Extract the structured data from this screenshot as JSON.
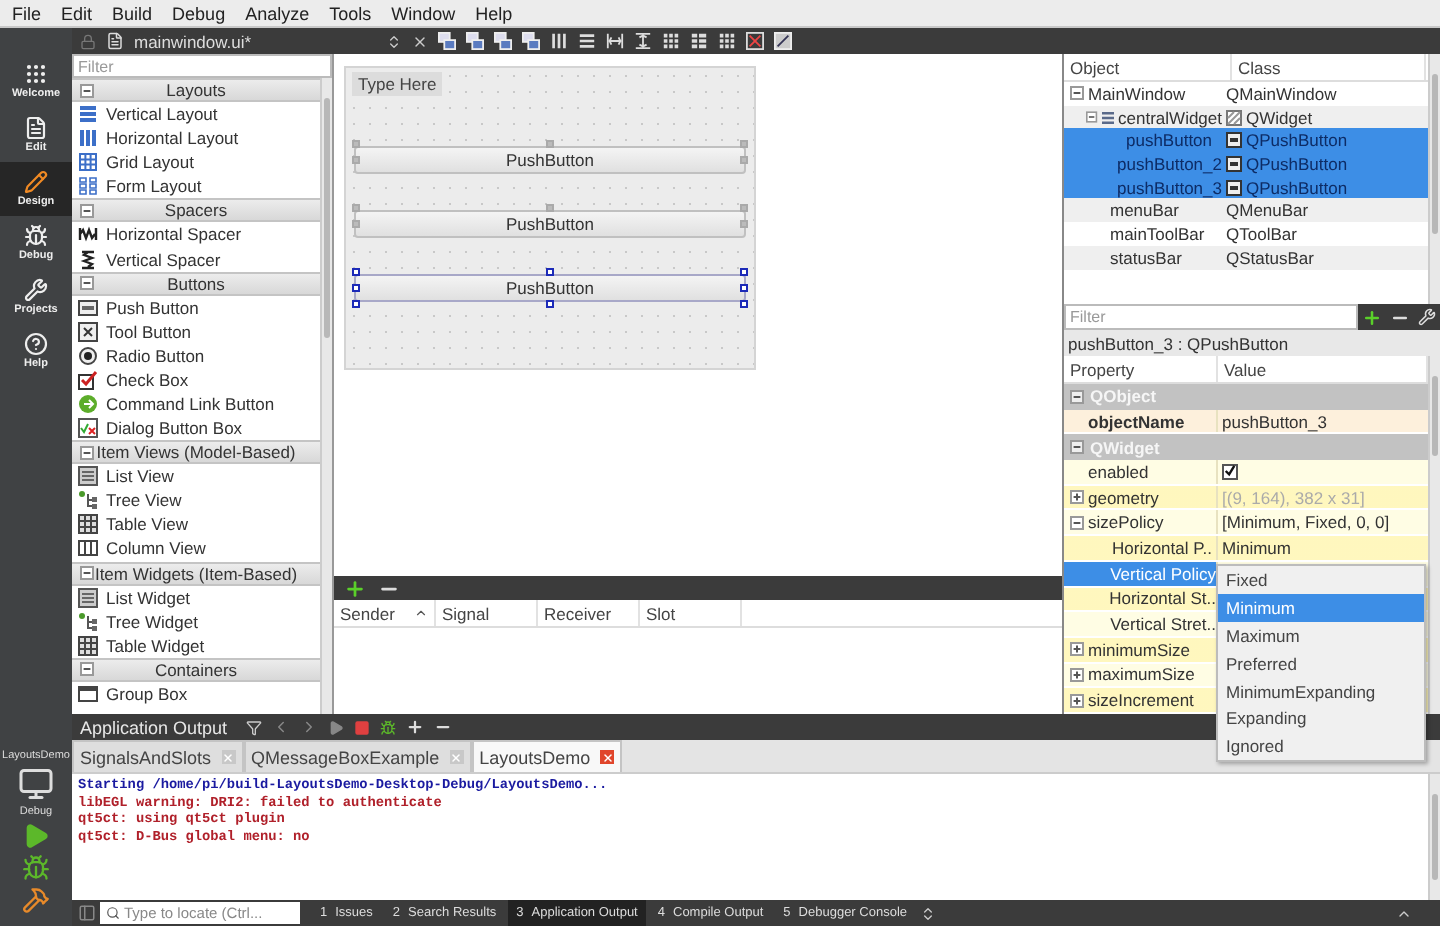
{
  "menu": [
    "File",
    "Edit",
    "Build",
    "Debug",
    "Analyze",
    "Tools",
    "Window",
    "Help"
  ],
  "mode_bar": {
    "modes": [
      {
        "label": "Welcome",
        "selected": false
      },
      {
        "label": "Edit",
        "selected": false
      },
      {
        "label": "Design",
        "selected": true
      },
      {
        "label": "Debug",
        "selected": false
      },
      {
        "label": "Projects",
        "selected": false
      },
      {
        "label": "Help",
        "selected": false
      }
    ],
    "project": "LayoutsDemo",
    "build": "Debug"
  },
  "editor_toolbar": {
    "file": "mainwindow.ui*"
  },
  "widget_box": {
    "filter_placeholder": "Filter",
    "categories": [
      {
        "title": "Layouts",
        "expanded": true,
        "items": [
          "Vertical Layout",
          "Horizontal Layout",
          "Grid Layout",
          "Form Layout"
        ]
      },
      {
        "title": "Spacers",
        "expanded": true,
        "items": [
          "Horizontal Spacer",
          "Vertical Spacer"
        ]
      },
      {
        "title": "Buttons",
        "expanded": true,
        "items": [
          "Push Button",
          "Tool Button",
          "Radio Button",
          "Check Box",
          "Command Link Button",
          "Dialog Button Box"
        ]
      },
      {
        "title": "Item Views (Model-Based)",
        "expanded": true,
        "items": [
          "List View",
          "Tree View",
          "Table View",
          "Column View"
        ]
      },
      {
        "title": "Item Widgets (Item-Based)",
        "expanded": true,
        "items": [
          "List Widget",
          "Tree Widget",
          "Table Widget"
        ]
      },
      {
        "title": "Containers",
        "expanded": true,
        "items": [
          "Group Box"
        ]
      }
    ]
  },
  "form": {
    "menu_placeholder": "Type Here",
    "buttons": [
      {
        "label": "PushButton",
        "selected": false
      },
      {
        "label": "PushButton",
        "selected": false
      },
      {
        "label": "PushButton",
        "selected": true
      }
    ]
  },
  "signal_slot": {
    "columns": [
      "Sender",
      "Signal",
      "Receiver",
      "Slot"
    ]
  },
  "object_inspector": {
    "columns": [
      "Object",
      "Class"
    ],
    "tree": [
      {
        "name": "MainWindow",
        "class": "QMainWindow",
        "selected": false,
        "expanded": true,
        "children": [
          {
            "name": "centralWidget",
            "class": "QWidget",
            "selected": false,
            "expanded": true,
            "children": [
              {
                "name": "pushButton",
                "class": "QPushButton",
                "selected": true
              },
              {
                "name": "pushButton_2",
                "class": "QPushButton",
                "selected": true
              },
              {
                "name": "pushButton_3",
                "class": "QPushButton",
                "selected": true
              }
            ]
          },
          {
            "name": "menuBar",
            "class": "QMenuBar",
            "selected": false
          },
          {
            "name": "mainToolBar",
            "class": "QToolBar",
            "selected": false
          },
          {
            "name": "statusBar",
            "class": "QStatusBar",
            "selected": false
          }
        ]
      }
    ]
  },
  "property_editor": {
    "filter_placeholder": "Filter",
    "title": "pushButton_3 : QPushButton",
    "columns": [
      "Property",
      "Value"
    ],
    "groups": [
      {
        "name": "QObject",
        "expanded": true,
        "color": "#fdf0dc",
        "rows": [
          {
            "kind": "text",
            "name": "objectName",
            "value": "pushButton_3",
            "bold": true,
            "selected": false
          }
        ]
      },
      {
        "name": "QWidget",
        "expanded": true,
        "color": "#fffde4",
        "rows": [
          {
            "kind": "checkbox",
            "name": "enabled",
            "checked": true,
            "bold": false,
            "selected": false
          },
          {
            "kind": "text",
            "name": "geometry",
            "value": "[(9, 164), 382 x 31]",
            "expanded": false,
            "bold": false,
            "disabled": true,
            "selected": false
          },
          {
            "kind": "text",
            "name": "sizePolicy",
            "value": "[Minimum, Fixed, 0, 0]",
            "expanded": true,
            "bold": false,
            "disabled": false,
            "selected": false,
            "children": [
              {
                "kind": "text",
                "name": "Horizontal P..",
                "value": "Minimum",
                "bold": false,
                "disabled": false,
                "selected": false
              },
              {
                "kind": "text",
                "name": "Vertical Policy",
                "bold": false,
                "selected": true
              },
              {
                "kind": "text",
                "name": "Horizontal St..",
                "bold": false,
                "selected": false
              },
              {
                "kind": "text",
                "name": "Vertical Stret..",
                "bold": false,
                "selected": false
              }
            ]
          },
          {
            "kind": "text",
            "name": "minimumSize",
            "expanded": false,
            "bold": false,
            "selected": false
          },
          {
            "kind": "text",
            "name": "maximumSize",
            "expanded": false,
            "bold": false,
            "selected": false
          },
          {
            "kind": "text",
            "name": "sizeIncrement",
            "expanded": false,
            "bold": false,
            "selected": false
          }
        ]
      }
    ]
  },
  "dropdown": {
    "options": [
      {
        "label": "Fixed",
        "selected": false
      },
      {
        "label": "Minimum",
        "selected": true
      },
      {
        "label": "Maximum",
        "selected": false
      },
      {
        "label": "Preferred",
        "selected": false
      },
      {
        "label": "MinimumExpanding",
        "selected": false
      },
      {
        "label": "Expanding",
        "selected": false
      },
      {
        "label": "Ignored",
        "selected": false
      }
    ]
  },
  "output": {
    "title": "Application Output",
    "tabs": [
      {
        "label": "SignalsAndSlots",
        "selected": false
      },
      {
        "label": "QMessageBoxExample",
        "selected": false
      },
      {
        "label": "LayoutsDemo",
        "selected": true
      }
    ],
    "lines": [
      {
        "kind": "info",
        "text": "Starting /home/pi/build-LayoutsDemo-Desktop-Debug/LayoutsDemo..."
      },
      {
        "kind": "error",
        "text": "libEGL warning: DRI2: failed to authenticate"
      },
      {
        "kind": "error",
        "text": "qt5ct: using qt5ct plugin"
      },
      {
        "kind": "error",
        "text": "qt5ct: D-Bus global menu: no"
      }
    ]
  },
  "status_bar": {
    "locator_placeholder": "Type to locate (Ctrl...",
    "panes": [
      {
        "number": "1",
        "label": "Issues",
        "selected": false
      },
      {
        "number": "2",
        "label": "Search Results",
        "selected": false
      },
      {
        "number": "3",
        "label": "Application Output",
        "selected": true
      },
      {
        "number": "4",
        "label": "Compile Output",
        "selected": false
      },
      {
        "number": "5",
        "label": "Debugger Console",
        "selected": false
      }
    ]
  }
}
